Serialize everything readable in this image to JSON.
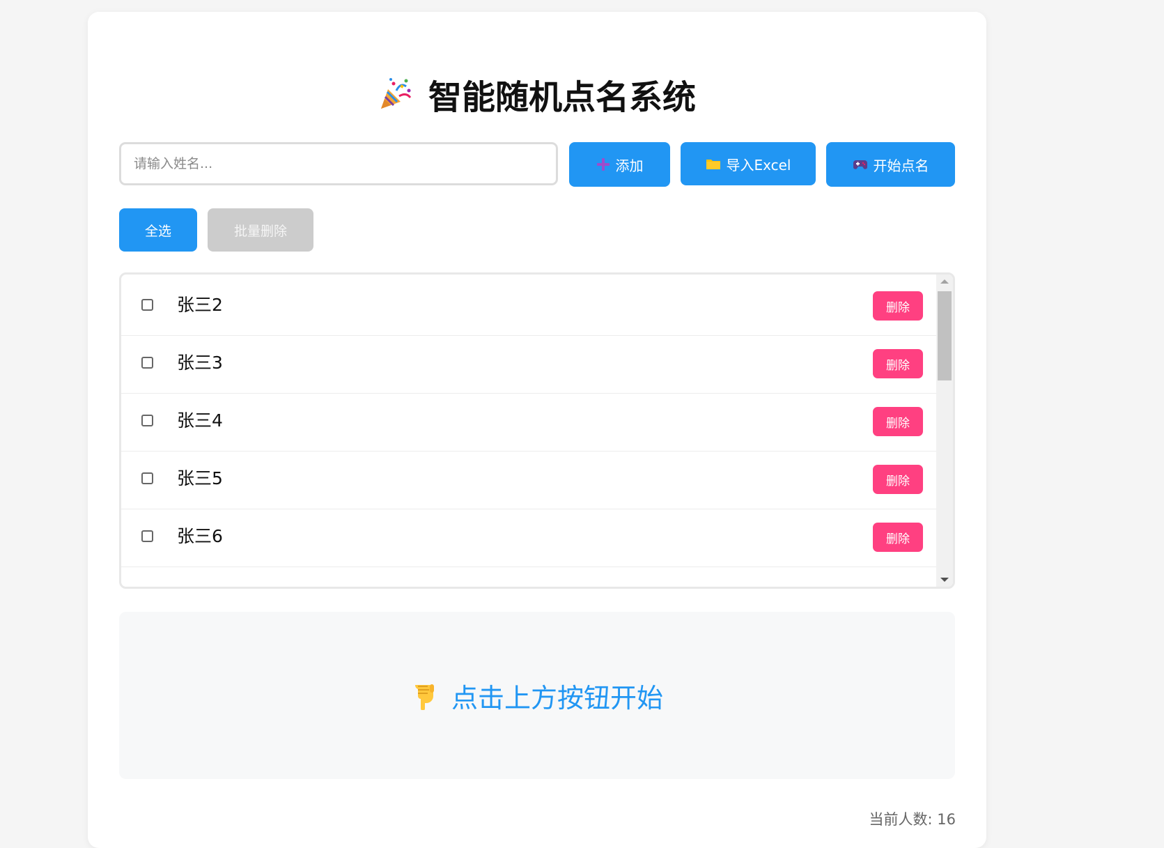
{
  "app": {
    "title": "智能随机点名系统"
  },
  "input": {
    "placeholder": "请输入姓名...",
    "value": ""
  },
  "toolbar": {
    "add_label": "添加",
    "import_label": "导入Excel",
    "start_label": "开始点名",
    "select_all_label": "全选",
    "batch_delete_label": "批量删除"
  },
  "list": {
    "delete_label": "删除",
    "items": [
      {
        "name": "张三2",
        "checked": false
      },
      {
        "name": "张三3",
        "checked": false
      },
      {
        "name": "张三4",
        "checked": false
      },
      {
        "name": "张三5",
        "checked": false
      },
      {
        "name": "张三6",
        "checked": false
      }
    ]
  },
  "result": {
    "prompt": "点击上方按钮开始"
  },
  "footer": {
    "count_text": "当前人数: 16"
  },
  "icons": {
    "title": "party-popper-icon",
    "add": "plus-icon",
    "import": "folder-icon",
    "start": "game-controller-icon",
    "result": "pointing-down-hand-icon"
  },
  "colors": {
    "primary": "#2196f3",
    "danger": "#ff4081",
    "disabled": "#cccccc",
    "add_icon": "#9c4dcc",
    "folder_icon": "#ffc107"
  }
}
